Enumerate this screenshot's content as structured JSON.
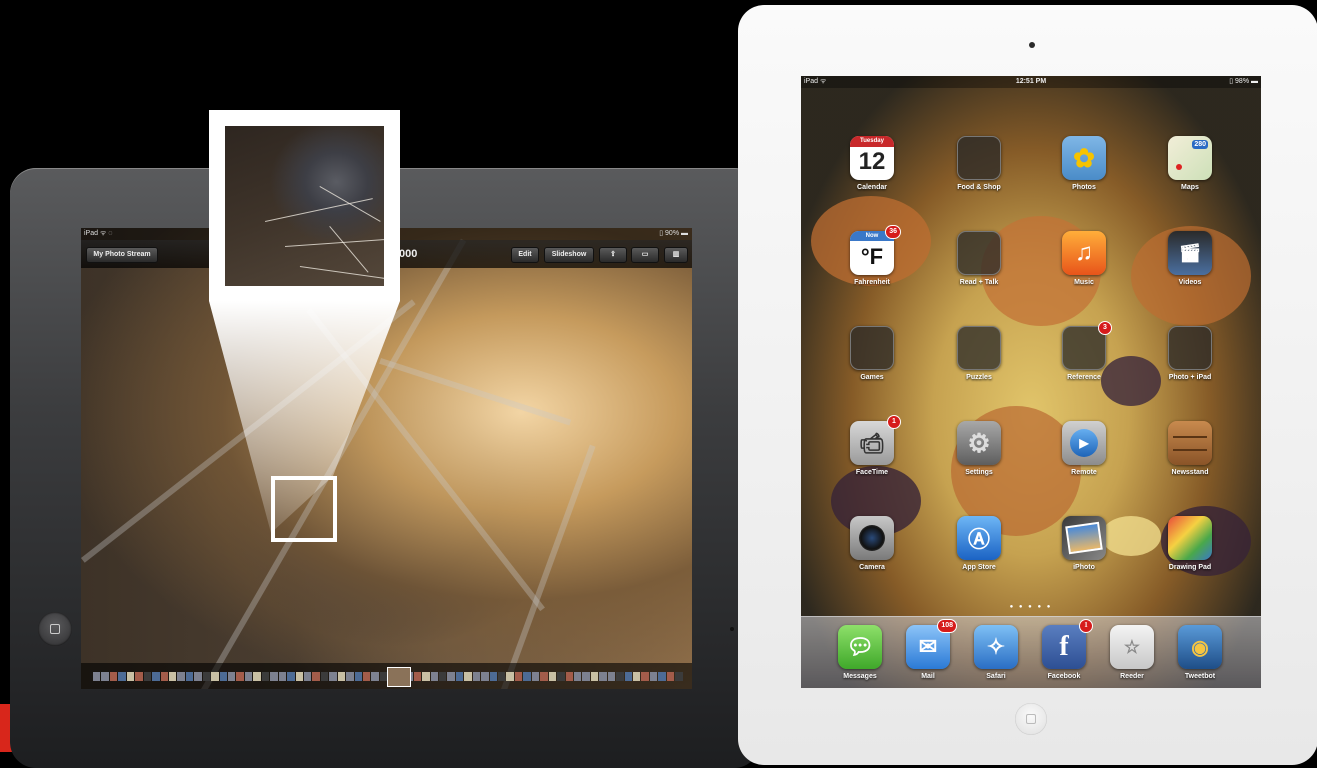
{
  "black_ipad": {
    "status": {
      "left": "iPad ᯤ ◌",
      "battery": "▯ 90% ▬"
    },
    "toolbar": {
      "back_label": "My Photo Stream",
      "title": "000",
      "edit_label": "Edit",
      "slideshow_label": "Slideshow",
      "share_icon": "share-icon",
      "airplay_icon": "airplay-icon",
      "trash_icon": "trash-icon"
    }
  },
  "white_ipad": {
    "status": {
      "left": "iPad ᯤ",
      "time": "12:51 PM",
      "battery": "▯ 98% ▬"
    },
    "apps": [
      {
        "label": "Calendar",
        "date_day": "Tuesday",
        "date_num": "12"
      },
      {
        "label": "Food & Shop"
      },
      {
        "label": "Photos"
      },
      {
        "label": "Maps",
        "sign": "280"
      },
      {
        "label": "Fahrenheit",
        "badge": "36",
        "sub": "Now",
        "glyph": "°F"
      },
      {
        "label": "Read + Talk"
      },
      {
        "label": "Music"
      },
      {
        "label": "Videos"
      },
      {
        "label": "Games"
      },
      {
        "label": "Puzzles"
      },
      {
        "label": "Reference",
        "badge": "3"
      },
      {
        "label": "Photo + iPad"
      },
      {
        "label": "FaceTime",
        "badge": "1"
      },
      {
        "label": "Settings"
      },
      {
        "label": "Remote"
      },
      {
        "label": "Newsstand"
      },
      {
        "label": "Camera"
      },
      {
        "label": "App Store"
      },
      {
        "label": "iPhoto"
      },
      {
        "label": "Drawing Pad"
      }
    ],
    "dock": [
      {
        "label": "Messages"
      },
      {
        "label": "Mail",
        "badge": "108"
      },
      {
        "label": "Safari"
      },
      {
        "label": "Facebook",
        "badge": "1"
      },
      {
        "label": "Reeder"
      },
      {
        "label": "Tweetbot"
      }
    ]
  }
}
